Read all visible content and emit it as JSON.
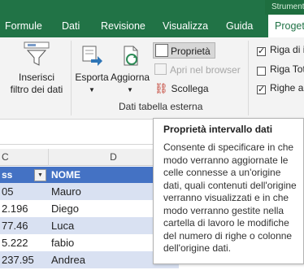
{
  "ribbon": {
    "tools_tab": "Strumenti",
    "tabs": [
      "Formule",
      "Dati",
      "Revisione",
      "Visualizza",
      "Guida",
      "Progettazione"
    ],
    "buttons": {
      "insert_slicer": [
        "Inserisci",
        "filtro dei dati"
      ],
      "export": "Esporta",
      "refresh": "Aggiorna",
      "properties": "Proprietà",
      "open_browser": "Apri nel browser",
      "unlink": "Scollega"
    },
    "group_label": "Dati tabella esterna",
    "options": [
      {
        "label": "Riga di i",
        "checked": true
      },
      {
        "label": "Riga Tot",
        "checked": false
      },
      {
        "label": "Righe al",
        "checked": true
      }
    ]
  },
  "sheet": {
    "column_headers": [
      "C",
      "D"
    ],
    "header_cells": [
      "ss",
      "NOME"
    ],
    "rows": [
      {
        "c": "05",
        "d": "Mauro"
      },
      {
        "c": "2.196",
        "d": "Diego"
      },
      {
        "c": "77.46",
        "d": "Luca"
      },
      {
        "c": "5.222",
        "d": "fabio"
      },
      {
        "c": "237.95",
        "d": "Andrea"
      }
    ]
  },
  "tooltip": {
    "title": "Proprietà intervallo dati",
    "body": "Consente di specificare in che modo verranno aggiornate le celle connesse a un'origine dati, quali contenuti dell'origine verranno visualizzati e in che modo verranno gestite nella cartella di lavoro le modifiche del numero di righe o colonne dell'origine dati."
  },
  "colors": {
    "excel_green": "#217346",
    "table_header": "#4472c4",
    "table_band": "#d9e1f2"
  }
}
